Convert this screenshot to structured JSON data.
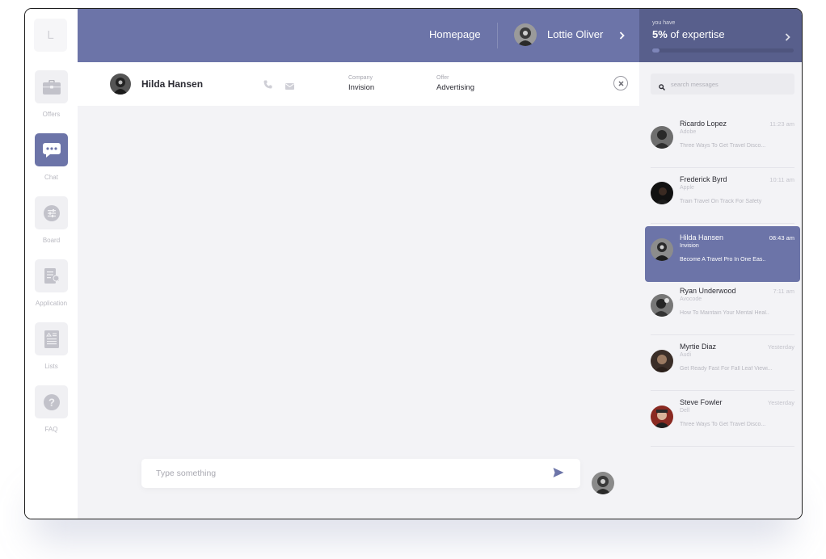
{
  "logo": {
    "letter": "L"
  },
  "sidebar": {
    "items": [
      {
        "label": "Offers",
        "icon": "briefcase-icon"
      },
      {
        "label": "Chat",
        "icon": "chat-bubble-icon"
      },
      {
        "label": "Board",
        "icon": "sliders-icon"
      },
      {
        "label": "Application",
        "icon": "document-edit-icon"
      },
      {
        "label": "Lists",
        "icon": "list-icon"
      },
      {
        "label": "FAQ",
        "icon": "question-icon"
      }
    ],
    "active": "Chat"
  },
  "topbar": {
    "homepage": "Homepage",
    "user_name": "Lottie Oliver"
  },
  "expertise": {
    "small": "you have",
    "percent_text": "5%",
    "suffix": " of expertise",
    "progress_fraction": 0.05
  },
  "chat_header": {
    "name": "Hilda Hansen",
    "company_label": "Company",
    "company_value": "Invision",
    "offer_label": "Offer",
    "offer_value": "Advertising"
  },
  "composer": {
    "placeholder": "Type something"
  },
  "search": {
    "placeholder": "search messages"
  },
  "conversations": [
    {
      "name": "Ricardo Lopez",
      "company": "Adobe",
      "time": "11:23 am",
      "preview": "Three Ways To Get Travel Disco..."
    },
    {
      "name": "Frederick Byrd",
      "company": "Apple",
      "time": "10:11 am",
      "preview": "Train Travel On Track For Safety"
    },
    {
      "name": "Hilda Hansen",
      "company": "Invision",
      "time": "08:43 am",
      "preview": "Become A Travel Pro In One Eas..",
      "active": true
    },
    {
      "name": "Ryan Underwood",
      "company": "Avocode",
      "time": "7:11 am",
      "preview": "How To Maintain Your Mental Heal.."
    },
    {
      "name": "Myrtie Diaz",
      "company": "Audi",
      "time": "Yesterday",
      "preview": "Get Ready Fast For Fall Leaf Viewi..."
    },
    {
      "name": "Steve Fowler",
      "company": "Dell",
      "time": "Yesterday",
      "preview": "Three Ways To Get Travel Disco..."
    }
  ],
  "colors": {
    "accent": "#6c74a8",
    "accent_dark": "#585f8c",
    "background": "#f3f3f6"
  }
}
